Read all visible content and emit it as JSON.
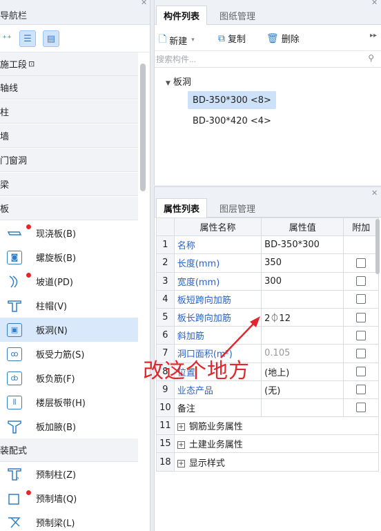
{
  "nav": {
    "title": "导航栏",
    "categories": [
      "施工段",
      "轴线",
      "柱",
      "墙",
      "门窗洞",
      "梁",
      "板",
      "装配式"
    ],
    "construction_lock_glyph": "🔒",
    "board_items": [
      {
        "label": "现浇板(B)",
        "icon": "cast-slab-icon",
        "dot": true
      },
      {
        "label": "螺旋板(B)",
        "icon": "spiral-slab-icon",
        "dot": false
      },
      {
        "label": "坡道(PD)",
        "icon": "ramp-icon",
        "dot": true
      },
      {
        "label": "柱帽(V)",
        "icon": "column-cap-icon",
        "dot": false
      },
      {
        "label": "板洞(N)",
        "icon": "slab-opening-icon",
        "dot": false,
        "selected": true
      },
      {
        "label": "板受力筋(S)",
        "icon": "slab-rebar-icon",
        "dot": false
      },
      {
        "label": "板负筋(F)",
        "icon": "negative-rebar-icon",
        "dot": false
      },
      {
        "label": "楼层板带(H)",
        "icon": "floor-strip-icon",
        "dot": false
      },
      {
        "label": "板加腋(B)",
        "icon": "slab-haunch-icon",
        "dot": false
      }
    ],
    "prefab_items": [
      {
        "label": "预制柱(Z)",
        "icon": "prefab-column-icon",
        "dot": false
      },
      {
        "label": "预制墙(Q)",
        "icon": "prefab-wall-icon",
        "dot": true
      },
      {
        "label": "预制梁(L)",
        "icon": "prefab-beam-icon",
        "dot": false
      }
    ]
  },
  "component_panel": {
    "tabs": [
      "构件列表",
      "图纸管理"
    ],
    "toolbar": {
      "new": "新建",
      "copy": "复制",
      "delete": "删除"
    },
    "search_placeholder": "搜索构件...",
    "tree_root": "板洞",
    "tree_items": [
      "BD-350*300 <8>",
      "BD-300*420 <4>"
    ]
  },
  "property_panel": {
    "tabs": [
      "属性列表",
      "图层管理"
    ],
    "headers": [
      "属性名称",
      "属性值",
      "附加"
    ],
    "rows": [
      {
        "num": "1",
        "name": "名称",
        "value": "BD-350*300",
        "checkbox": false,
        "blue": true
      },
      {
        "num": "2",
        "name": "长度(mm)",
        "value": "350",
        "checkbox": true,
        "blue": true
      },
      {
        "num": "3",
        "name": "宽度(mm)",
        "value": "300",
        "checkbox": true,
        "blue": true
      },
      {
        "num": "4",
        "name": "板短跨向加筋",
        "value": "",
        "checkbox": true,
        "blue": true
      },
      {
        "num": "5",
        "name": "板长跨向加筋",
        "value": "2⏀12",
        "checkbox": true,
        "blue": true
      },
      {
        "num": "6",
        "name": "斜加筋",
        "value": "",
        "checkbox": true,
        "blue": true
      },
      {
        "num": "7",
        "name": "洞口面积(m²)",
        "value": "0.105",
        "checkbox": true,
        "blue": true,
        "gray": true
      },
      {
        "num": "8",
        "name": "位置",
        "value": "(地上)",
        "checkbox": true,
        "blue": true
      },
      {
        "num": "9",
        "name": "业态产品",
        "value": "(无)",
        "checkbox": true,
        "blue": true
      },
      {
        "num": "10",
        "name": "备注",
        "value": "",
        "checkbox": true,
        "blue": false
      }
    ],
    "groups": [
      {
        "num": "11",
        "name": "钢筋业务属性"
      },
      {
        "num": "15",
        "name": "土建业务属性"
      },
      {
        "num": "18",
        "name": "显示样式"
      }
    ]
  },
  "annotation": {
    "text": "改这个地方",
    "color": "#e3262c"
  }
}
